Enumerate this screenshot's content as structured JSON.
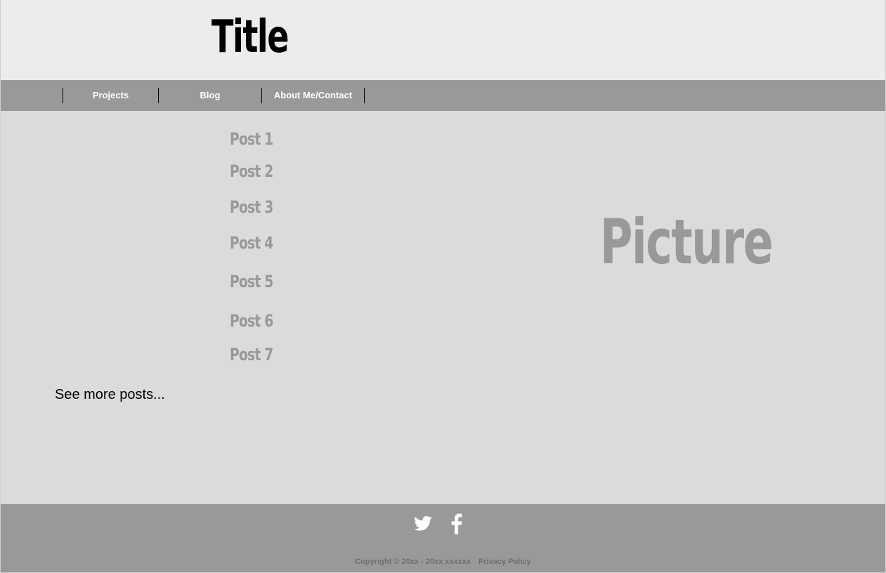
{
  "header": {
    "title": "Title"
  },
  "nav": {
    "items": [
      {
        "label": "Projects"
      },
      {
        "label": "Blog"
      },
      {
        "label": "About Me/Contact"
      }
    ]
  },
  "main": {
    "posts": [
      {
        "label": "Post 1"
      },
      {
        "label": "Post 2"
      },
      {
        "label": "Post 3"
      },
      {
        "label": "Post 4"
      },
      {
        "label": "Post 5"
      },
      {
        "label": "Post 6"
      },
      {
        "label": "Post 7"
      }
    ],
    "see_more": "See more posts...",
    "picture_placeholder": "Picture"
  },
  "footer": {
    "social_icons": [
      "twitter-icon",
      "facebook-icon"
    ],
    "copyright": "Copyright © 20xx - 20xx xxxxxx",
    "privacy": "Privacy Policy"
  },
  "colors": {
    "header_bg": "#ececec",
    "nav_bg": "#999999",
    "main_bg": "#dbdbdb",
    "footer_bg": "#999999",
    "muted_text": "#999999"
  }
}
